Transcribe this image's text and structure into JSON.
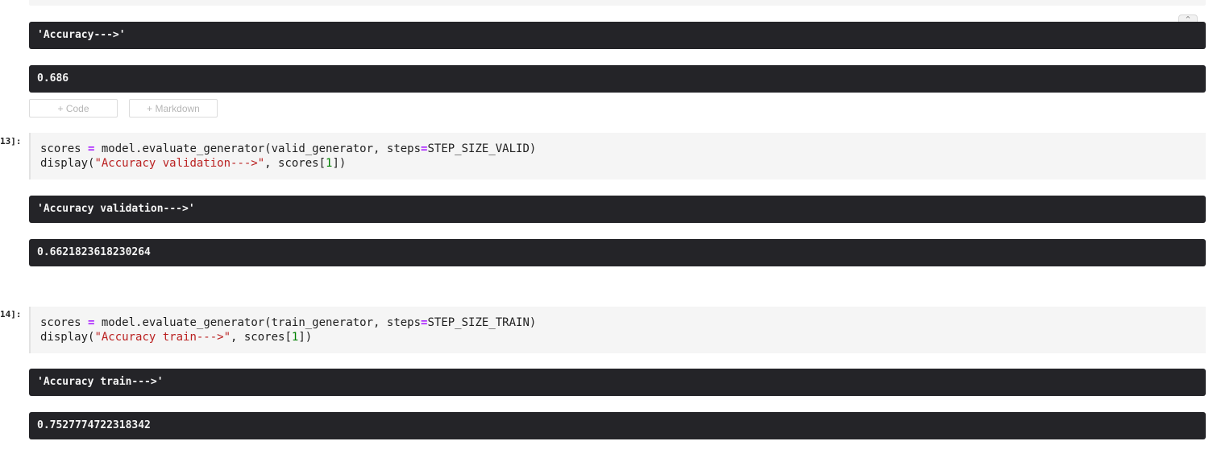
{
  "collapse_icon": "collapse-chevrons-icon",
  "outputs": {
    "accuracy_label": "'Accuracy--->'",
    "accuracy_value": "0.686",
    "validation_label": "'Accuracy validation--->'",
    "validation_value": "0.6621823618230264",
    "train_label": "'Accuracy train--->'",
    "train_value": "0.7527774722318342"
  },
  "add_buttons": {
    "code": "+ Code",
    "markdown": "+ Markdown"
  },
  "cells": [
    {
      "prompt": "13]:",
      "line1": {
        "a": "scores ",
        "op": "=",
        "b": " model.evaluate_generator(valid_generator, steps",
        "op2": "=",
        "c": "STEP_SIZE_VALID)"
      },
      "line2": {
        "a": "display(",
        "str": "\"Accuracy validation--->\"",
        "b": ", scores[",
        "num": "1",
        "c": "])"
      }
    },
    {
      "prompt": "14]:",
      "line1": {
        "a": "scores ",
        "op": "=",
        "b": " model.evaluate_generator(train_generator, steps",
        "op2": "=",
        "c": "STEP_SIZE_TRAIN)"
      },
      "line2": {
        "a": "display(",
        "str": "\"Accuracy train--->\"",
        "b": ", scores[",
        "num": "1",
        "c": "])"
      }
    }
  ]
}
